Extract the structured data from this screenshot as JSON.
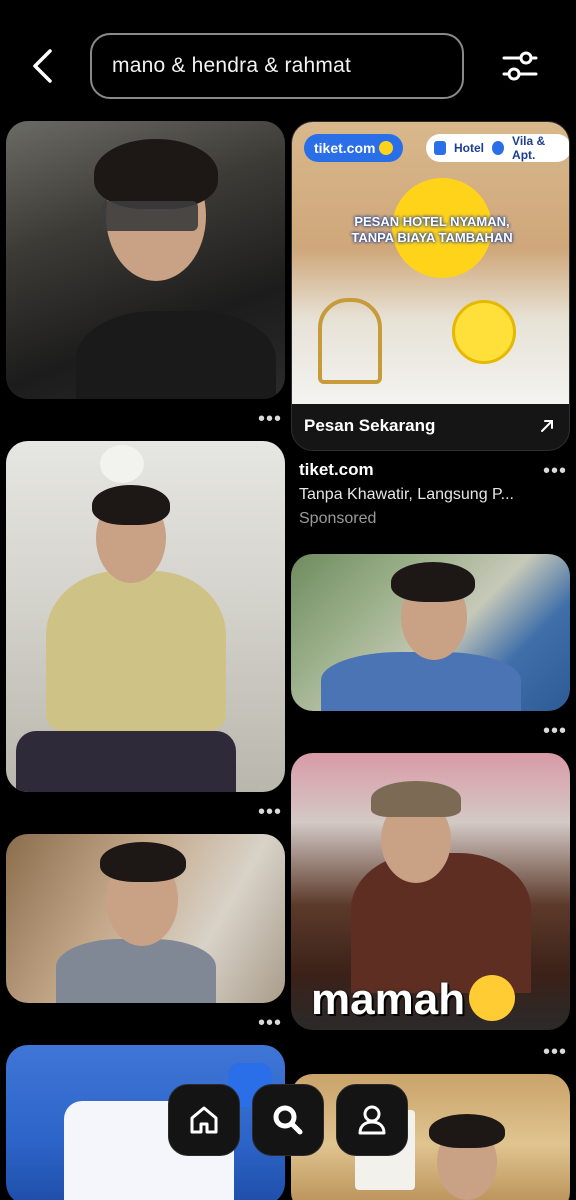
{
  "header": {
    "search_query": "mano & hendra & rahmat",
    "back_icon": "chevron-left-icon",
    "filter_icon": "sliders-icon"
  },
  "feed": {
    "more_label": "•••",
    "ad": {
      "logo": "tiket.com",
      "chip_hotel": "Hotel",
      "chip_vila": "Vila & Apt.",
      "headline_1": "PESAN HOTEL NYAMAN,",
      "headline_2": "TANPA BIAYA TAMBAHAN",
      "cta": "Pesan Sekarang",
      "brand": "tiket.com",
      "description": "Tanpa Khawatir, Langsung P...",
      "sponsored": "Sponsored"
    },
    "meme_caption": "mamah"
  },
  "nav": {
    "items": [
      "home-icon",
      "search-icon",
      "profile-icon"
    ],
    "accent": "#ffffff"
  }
}
